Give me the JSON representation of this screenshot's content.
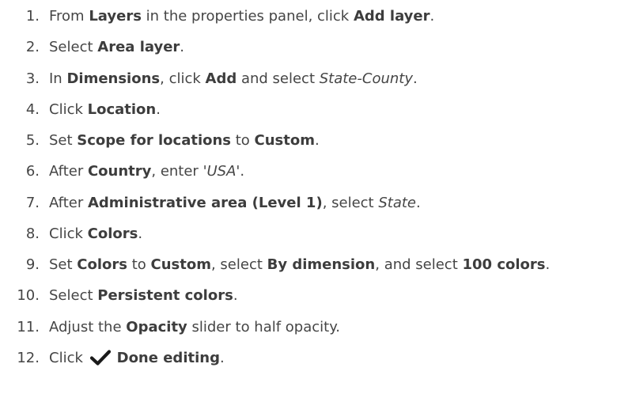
{
  "steps": [
    {
      "num": "1.",
      "parts": [
        "From ",
        "Layers",
        " in the properties panel, click ",
        "Add layer",
        "."
      ]
    },
    {
      "num": "2.",
      "parts": [
        "Select ",
        "Area layer",
        "."
      ]
    },
    {
      "num": "3.",
      "parts": [
        "In ",
        "Dimensions",
        ", click ",
        "Add",
        " and select ",
        "State-County",
        "."
      ]
    },
    {
      "num": "4.",
      "parts": [
        "Click ",
        "Location",
        "."
      ]
    },
    {
      "num": "5.",
      "parts": [
        "Set ",
        "Scope for locations",
        " to ",
        "Custom",
        "."
      ]
    },
    {
      "num": "6.",
      "parts": [
        "After ",
        "Country",
        ", enter ",
        "'USA'",
        "."
      ]
    },
    {
      "num": "7.",
      "parts": [
        "After ",
        "Administrative area (Level 1)",
        ", select ",
        "State",
        "."
      ]
    },
    {
      "num": "8.",
      "parts": [
        "Click ",
        "Colors",
        "."
      ]
    },
    {
      "num": "9.",
      "parts": [
        "Set ",
        "Colors",
        " to ",
        "Custom",
        ", select ",
        "By dimension",
        ", and select ",
        "100 colors",
        "."
      ]
    },
    {
      "num": "10.",
      "parts": [
        "Select ",
        "Persistent colors",
        "."
      ]
    },
    {
      "num": "11.",
      "parts": [
        "Adjust the ",
        "Opacity",
        " slider to half opacity."
      ]
    },
    {
      "num": "12.",
      "parts": [
        "Click ",
        "Done editing",
        "."
      ],
      "icon": "checkmark-icon"
    }
  ]
}
